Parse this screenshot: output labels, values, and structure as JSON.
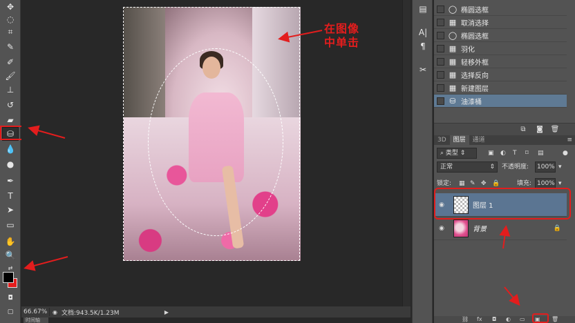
{
  "canvas": {
    "annotation_line1": "在图像",
    "annotation_line2": "中单击"
  },
  "status": {
    "zoom": "66.67%",
    "doc_info": "文档:943.5K/1.23M",
    "bottom_tab": "时间轴"
  },
  "toolbar": {
    "tools": [
      "move-tool",
      "marquee-tool",
      "crop-tool",
      "eyedropper-tool",
      "healing-brush-tool",
      "brush-tool",
      "clone-stamp-tool",
      "history-brush-tool",
      "eraser-tool",
      "paint-bucket-tool",
      "blur-tool",
      "dodge-tool",
      "pen-tool",
      "type-tool",
      "path-selection-tool",
      "rectangle-tool",
      "hand-tool",
      "zoom-tool"
    ],
    "foreground_color": "#000000",
    "background_color": "#e31d1d"
  },
  "history": {
    "items": [
      {
        "icon": "ellipse-marquee-icon",
        "label": "椭圆选框"
      },
      {
        "icon": "history-step-icon",
        "label": "取消选择"
      },
      {
        "icon": "ellipse-marquee-icon",
        "label": "椭圆选框"
      },
      {
        "icon": "history-step-icon",
        "label": "羽化"
      },
      {
        "icon": "history-step-icon",
        "label": "轻移外框"
      },
      {
        "icon": "history-step-icon",
        "label": "选择反向"
      },
      {
        "icon": "history-step-icon",
        "label": "新建图层"
      },
      {
        "icon": "paint-bucket-icon",
        "label": "油漆桶"
      }
    ],
    "selected_index": 7
  },
  "layers": {
    "tabs": [
      "3D",
      "图层",
      "通道"
    ],
    "active_tab": 1,
    "filter_label": "类型",
    "blend_mode": "正常",
    "opacity_label": "不透明度:",
    "opacity_value": "100%",
    "lock_label": "锁定:",
    "fill_label": "填充:",
    "fill_value": "100%",
    "rows": [
      {
        "name": "图层 1",
        "thumb": "transparent",
        "selected": true
      },
      {
        "name": "背景",
        "thumb": "photo",
        "selected": false,
        "locked": true
      }
    ]
  },
  "colors": {
    "annotation_red": "#e31d1d",
    "selection_blue": "#5b7592"
  }
}
